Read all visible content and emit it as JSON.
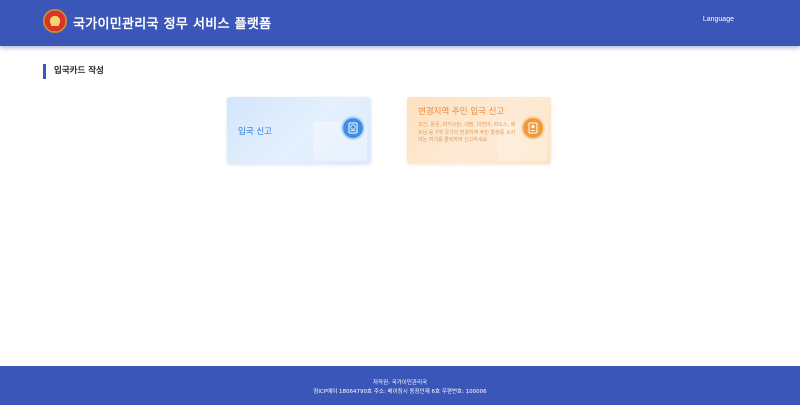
{
  "header": {
    "title": "국가이민관리국 정무 서비스 플랫폼",
    "language_label": "Language",
    "emblem_icon": "national-emblem-icon"
  },
  "main": {
    "section_title": "입국카드 작성",
    "cards": [
      {
        "title": "입국 신고",
        "icon": "passport-globe-icon",
        "accent": "#2f7be0"
      },
      {
        "title": "변경지역 주민 입국 신고",
        "description": "조선, 몽골, 파키스탄, 네팔, 미얀마, 라오스, 베트남 등 7개 국가의 변경지역 주민 통행증 소지자는 여기를 클릭하여 신고하세요.",
        "icon": "resident-id-icon",
        "accent": "#ea8a3a"
      }
    ]
  },
  "footer": {
    "copyright": "저작권: 국가이민관리국",
    "info": "징ICP예이 18064790호 주소: 베이징시 동장안제 6호 우편번호: 100006"
  },
  "colors": {
    "brand": "#3a56b8"
  }
}
